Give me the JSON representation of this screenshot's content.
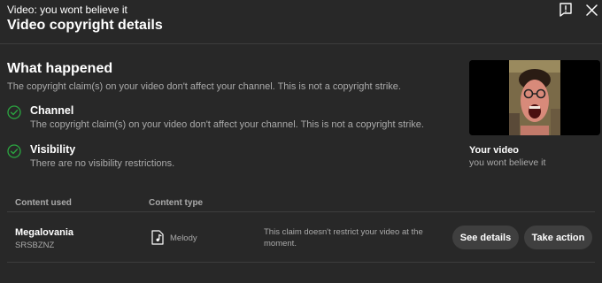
{
  "header": {
    "video_subtitle": "Video: you wont believe it",
    "title": "Video copyright details",
    "feedback_icon": "feedback-icon",
    "close_icon": "close-icon"
  },
  "what_happened": {
    "title": "What happened",
    "description": "The copyright claim(s) on your video don't affect your channel. This is not a copyright strike.",
    "items": [
      {
        "title": "Channel",
        "description": "The copyright claim(s) on your video don't affect your channel. This is not a copyright strike.",
        "icon": "check-circle-icon"
      },
      {
        "title": "Visibility",
        "description": "There are no visibility restrictions.",
        "icon": "check-circle-icon"
      }
    ]
  },
  "video": {
    "label": "Your video",
    "name": "you wont believe it"
  },
  "table": {
    "headers": {
      "content_used": "Content used",
      "content_type": "Content type"
    },
    "rows": [
      {
        "title": "Megalovania",
        "artist": "SRSBZNZ",
        "type_icon": "music-note-icon",
        "type": "Melody",
        "claim_status": "This claim doesn't restrict your video at the moment.",
        "actions": {
          "see_details": "See details",
          "take_action": "Take action"
        }
      }
    ]
  },
  "colors": {
    "background": "#282828",
    "check_green": "#2ba640",
    "button_bg": "#3f3f3f",
    "secondary_text": "#aaaaaa"
  }
}
